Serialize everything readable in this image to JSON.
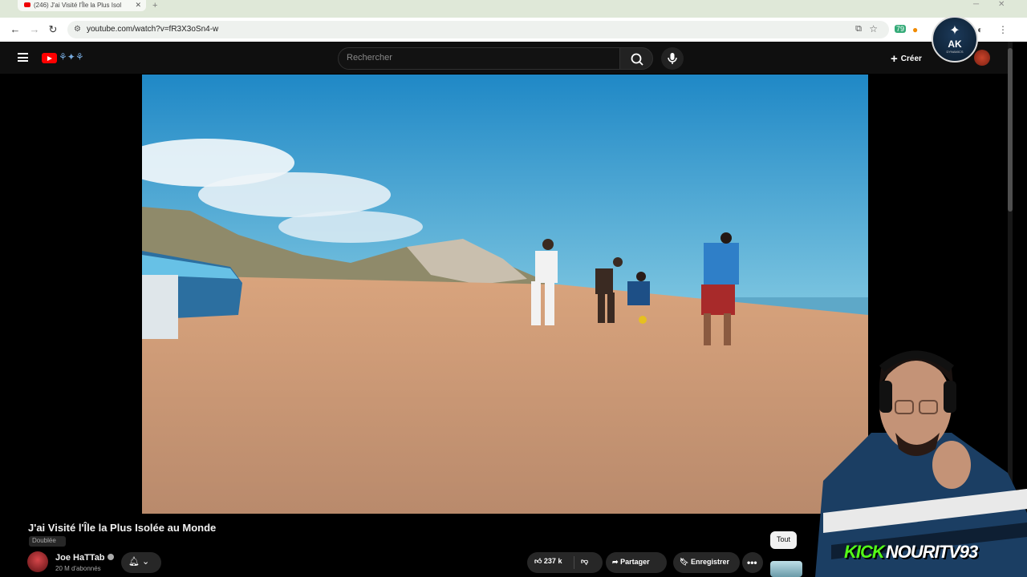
{
  "browser": {
    "tab_title": "(246) J'ai Visité l'Île la Plus Isol",
    "url": "youtube.com/watch?v=fR3X3oSn4-w",
    "new_tab": "+",
    "extension_badge": "79"
  },
  "youtube": {
    "search_placeholder": "Rechercher",
    "create_label": "Créer",
    "video": {
      "title": "J'ai Visité l'Île la Plus Isolée au Monde",
      "badge": "Doublée",
      "channel_name": "Joe HaTTab",
      "subscribers": "20 M d'abonnés",
      "likes": "237 k",
      "share_label": "Partager",
      "save_label": "Enregistrer",
      "more_label": "•••"
    },
    "filter_chip": "Tout"
  },
  "overlay": {
    "badge_text": "AK",
    "badge_sub": "DYNAMICS",
    "stream_platform": "KICK",
    "stream_handle": "NOURITV93"
  },
  "colors": {
    "youtube_red": "#ff0000",
    "kick_green": "#53fc18",
    "header_bg": "#0f0f0f"
  },
  "icons": [
    "menu-icon",
    "youtube-logo-icon",
    "search-icon",
    "mic-icon",
    "create-plus-icon",
    "bell-icon",
    "like-icon",
    "dislike-icon",
    "share-icon",
    "save-icon",
    "more-icon"
  ]
}
